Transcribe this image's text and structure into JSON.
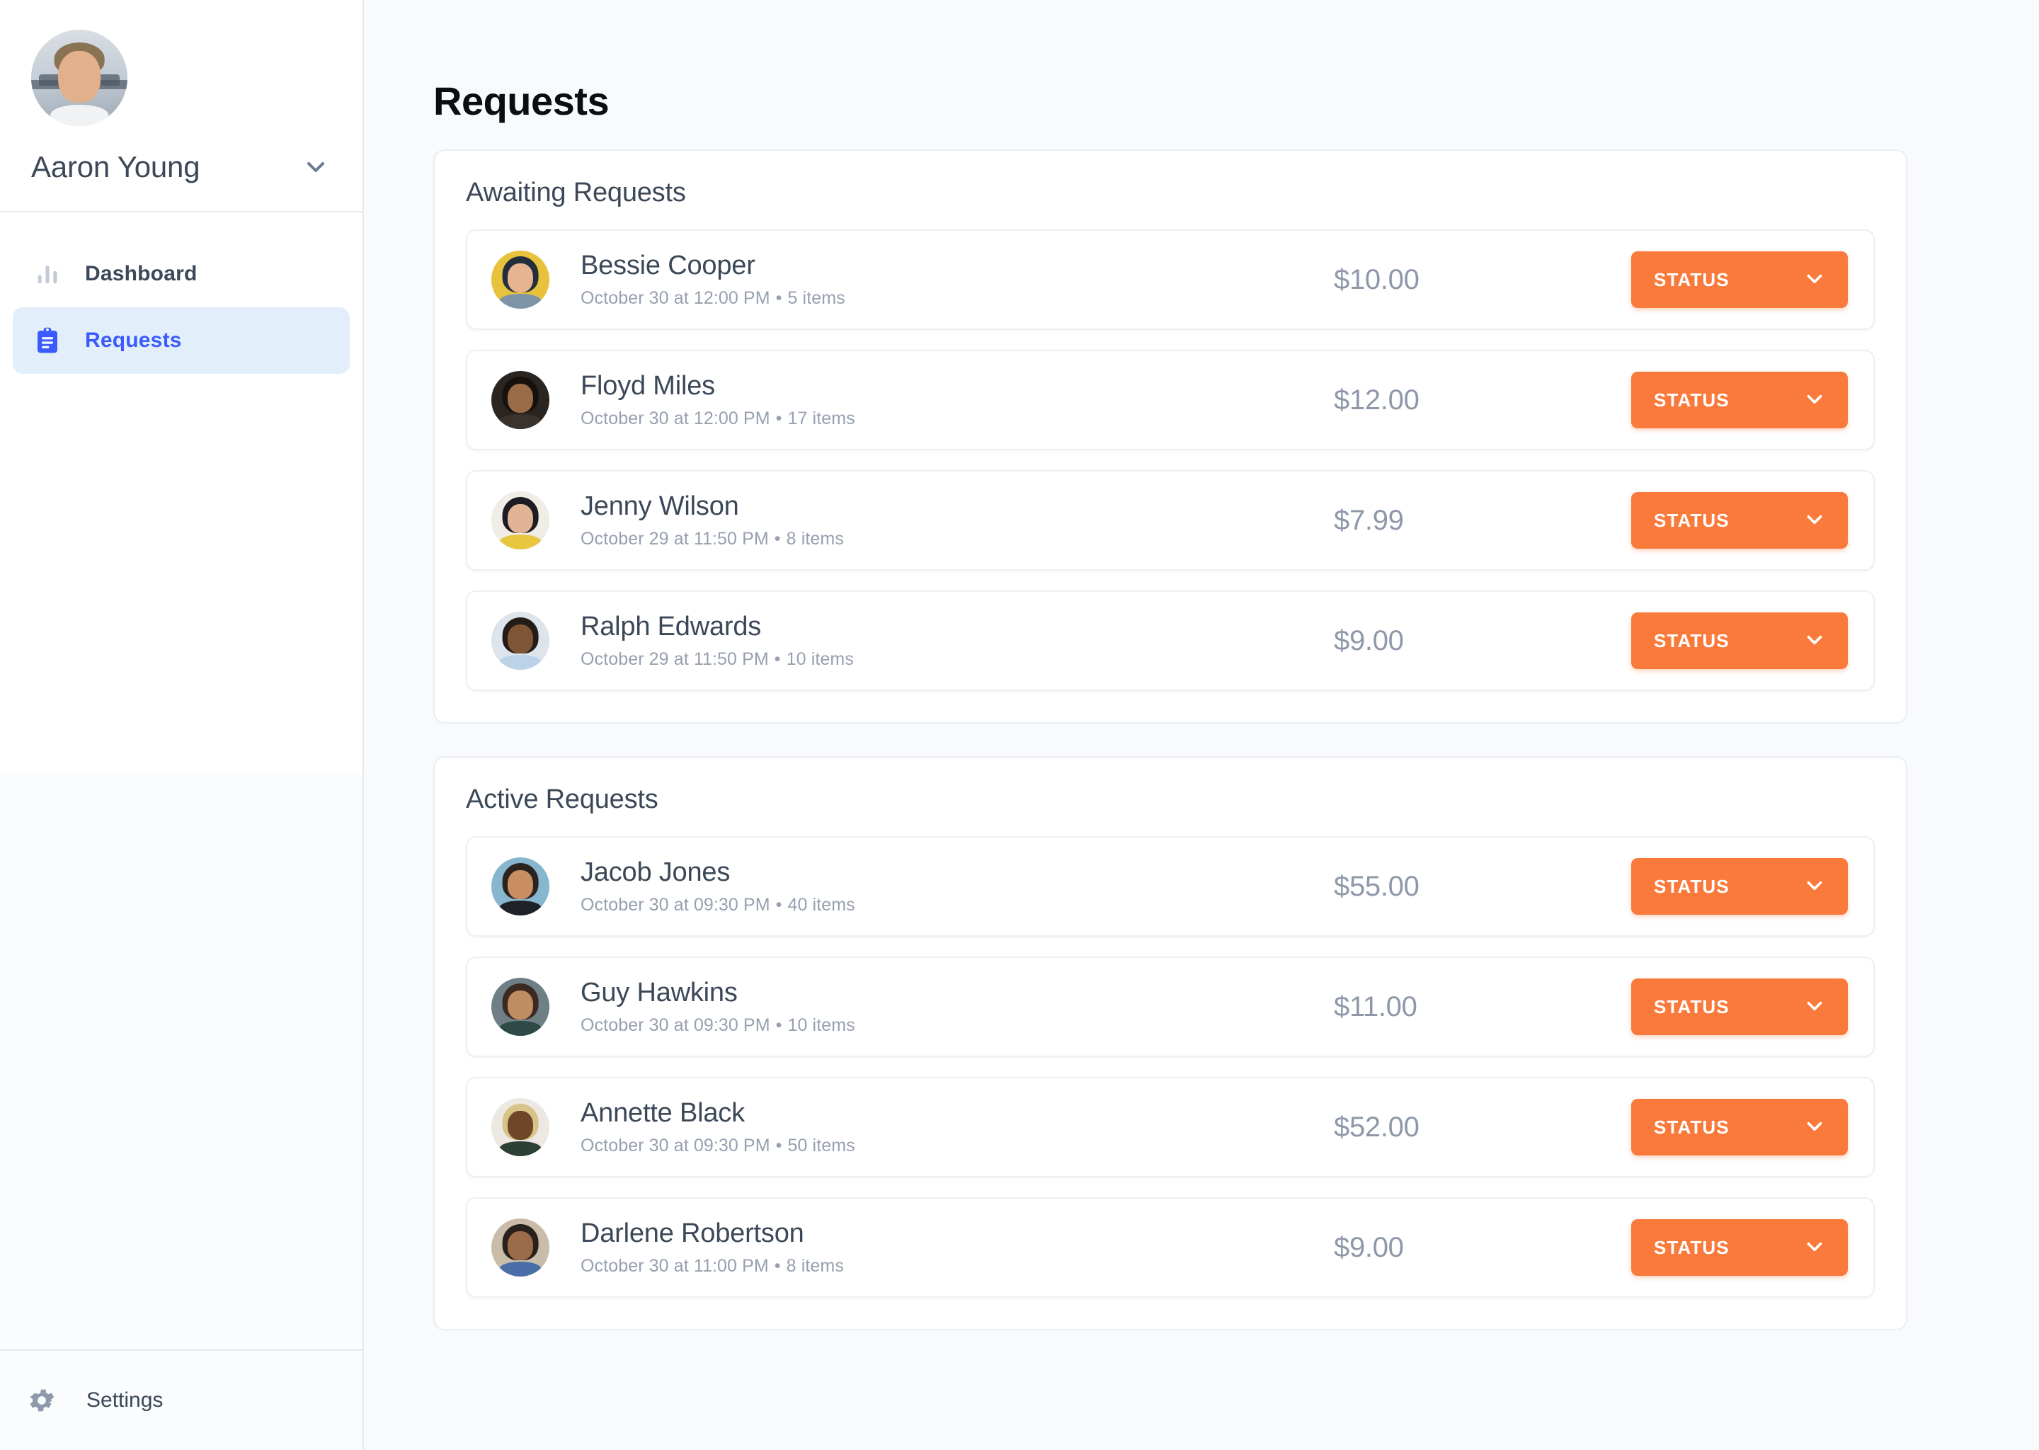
{
  "sidebar": {
    "user": {
      "name": "Aaron Young",
      "chevron_icon": "chevron-down-icon",
      "avatar_icon": "user-avatar"
    },
    "items": [
      {
        "label": "Dashboard",
        "icon": "bar-chart-icon",
        "active": false
      },
      {
        "label": "Requests",
        "icon": "clipboard-icon",
        "active": true
      }
    ],
    "settings": {
      "label": "Settings",
      "icon": "gear-icon"
    }
  },
  "main": {
    "page_title": "Requests",
    "sections": [
      {
        "title": "Awaiting Requests",
        "rows": [
          {
            "name": "Bessie Cooper",
            "date": "October 30 at 12:00 PM",
            "items": "5 items",
            "amount": "$10.00",
            "status_label": "STATUS"
          },
          {
            "name": "Floyd Miles",
            "date": "October 30 at 12:00 PM",
            "items": "17 items",
            "amount": "$12.00",
            "status_label": "STATUS"
          },
          {
            "name": "Jenny Wilson",
            "date": "October 29 at 11:50 PM",
            "items": "8 items",
            "amount": "$7.99",
            "status_label": "STATUS"
          },
          {
            "name": "Ralph Edwards",
            "date": "October 29 at 11:50 PM",
            "items": "10 items",
            "amount": "$9.00",
            "status_label": "STATUS"
          }
        ]
      },
      {
        "title": "Active Requests",
        "rows": [
          {
            "name": "Jacob Jones",
            "date": "October 30 at 09:30 PM",
            "items": "40 items",
            "amount": "$55.00",
            "status_label": "STATUS"
          },
          {
            "name": "Guy Hawkins",
            "date": "October 30 at 09:30 PM",
            "items": "10 items",
            "amount": "$11.00",
            "status_label": "STATUS"
          },
          {
            "name": "Annette Black",
            "date": "October 30 at 09:30 PM",
            "items": "50 items",
            "amount": "$52.00",
            "status_label": "STATUS"
          },
          {
            "name": "Darlene Robertson",
            "date": "October 30 at 11:00 PM",
            "items": "8 items",
            "amount": "$9.00",
            "status_label": "STATUS"
          }
        ]
      }
    ],
    "separator": "•"
  },
  "colors": {
    "accent_orange": "#FA7A3C",
    "nav_active_blue": "#3B5BFD",
    "nav_active_bg": "#E2EFFB",
    "page_bg": "#F8FAFC",
    "text_primary": "#3C4858",
    "text_muted": "#97A0B0",
    "amount_text": "#8E98A9"
  }
}
